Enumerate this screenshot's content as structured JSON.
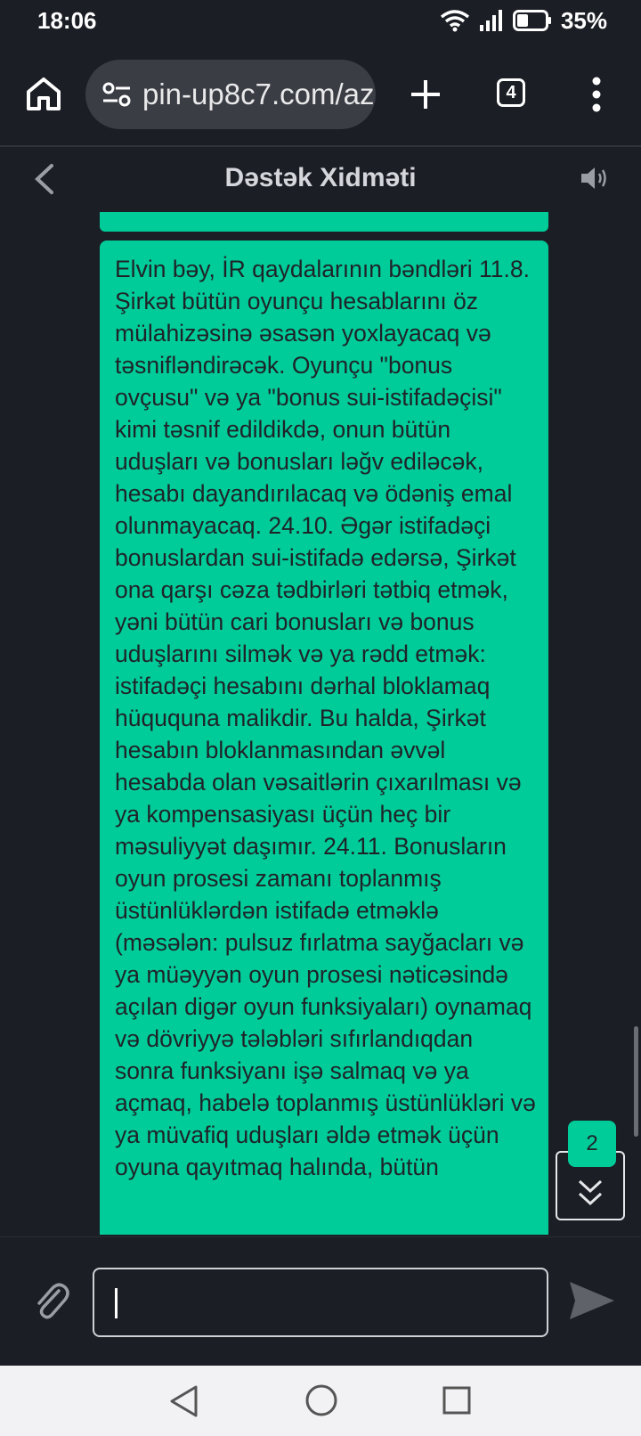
{
  "status_bar": {
    "time": "18:06",
    "battery": "35%"
  },
  "browser": {
    "url": "pin-up8c7.com/az",
    "tab_count": "4"
  },
  "header": {
    "title": "Dəstək Xidməti"
  },
  "chat": {
    "message": "Elvin bəy, İR qaydalarının bəndləri 11.8. Şirkət bütün oyunçu hesablarını öz mülahizəsinə əsasən yoxlayacaq və təsnifləndirəcək. Oyunçu \"bonus ovçusu\" və ya \"bonus sui-istifadəçisi\" kimi təsnif edildikdə, onun bütün uduşları və bonusları ləğv ediləcək, hesabı dayandırılacaq və ödəniş emal olunmayacaq. 24.10. Əgər istifadəçi bonuslardan sui-istifadə edərsə, Şirkət ona qarşı cəza tədbirləri tətbiq etmək, yəni bütün cari bonusları və bonus uduşlarını silmək və ya rədd etmək: istifadəçi hesabını dərhal bloklamaq hüququna malikdir. Bu halda, Şirkət hesabın bloklanmasından əvvəl hesabda olan vəsaitlərin çıxarılması və ya kompensasiyası üçün heç bir məsuliyyət daşımır. 24.11. Bonusların oyun prosesi zamanı toplanmış üstünlüklərdən istifadə etməklə (məsələn: pulsuz fırlatma sayğacları və ya müəyyən oyun prosesi nəticəsində açılan digər oyun funksiyaları) oynamaq və dövriyyə tələbləri sıfırlandıqdan sonra funksiyanı işə salmaq və ya açmaq, habelə toplanmış üstünlükləri və ya müvafiq uduşları əldə etmək üçün oyuna qayıtmaq halında, bütün",
    "unread_count": "2"
  },
  "composer": {
    "input_value": ""
  },
  "colors": {
    "accent": "#00cc9a",
    "background": "#1b1e24"
  }
}
